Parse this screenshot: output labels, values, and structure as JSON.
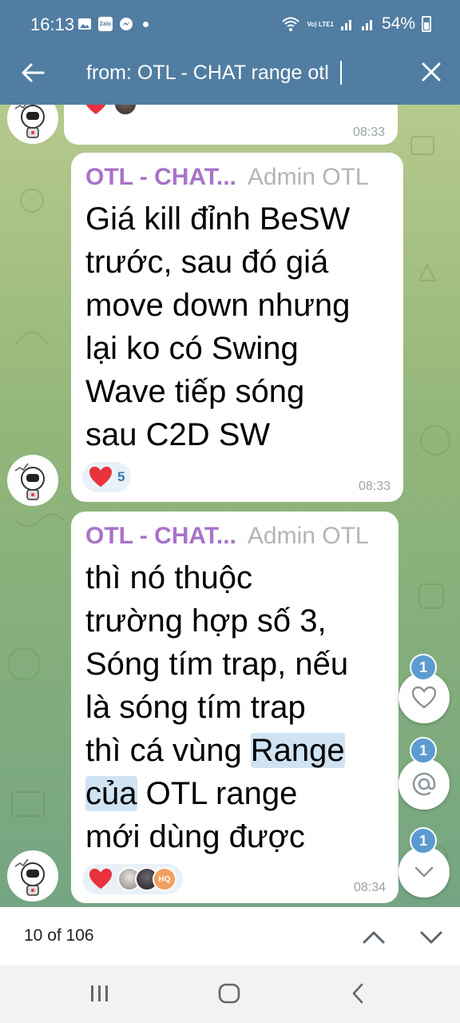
{
  "status_bar": {
    "time": "16:13",
    "notification_icons": [
      "gallery-icon",
      "zalo-icon",
      "messenger-icon"
    ],
    "zalo_text": "Zalo",
    "volte_text": "Vo) LTE1",
    "battery": "54%"
  },
  "search": {
    "query": "from: OTL - CHAT range otl"
  },
  "messages": [
    {
      "time": "08:33",
      "reactions": {
        "emoji": "heart"
      }
    },
    {
      "sender": "OTL - CHAT...",
      "role": "Admin OTL",
      "lines": [
        "Giá kill đỉnh BeSW",
        "trước, sau đó giá",
        "move down nhưng",
        "lại ko có Swing",
        "Wave tiếp sóng",
        "sau C2D SW"
      ],
      "time": "08:33",
      "reactions": {
        "emoji": "heart",
        "count": "5"
      }
    },
    {
      "sender": "OTL - CHAT...",
      "role": "Admin OTL",
      "line1": "thì nó thuộc",
      "line2": "trường hợp số 3,",
      "line3": "Sóng tím trap, nếu",
      "line4": "là sóng tím trap",
      "line5_pre": "thì cá vùng ",
      "line5_hl": "Range",
      "line6_hl": "của",
      "line6_post": " OTL range",
      "line7": "mới dùng được",
      "time": "08:34",
      "reactions": {
        "emoji": "heart",
        "avatar_label": "HQ"
      }
    }
  ],
  "floating": {
    "reactions_badge": "1",
    "mentions_badge": "1",
    "scroll_badge": "1"
  },
  "search_nav": {
    "counter": "10 of 106"
  },
  "colors": {
    "header": "#517da2",
    "sender": "#a873c8",
    "badge": "#5b9bd0",
    "highlight": "#cfe3f3",
    "heart": "#e8323c"
  }
}
